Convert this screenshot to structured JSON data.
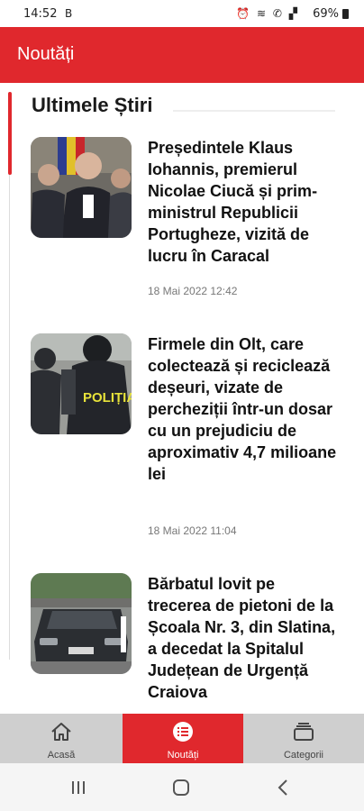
{
  "status_bar": {
    "time": "14:52",
    "left_icon": "B",
    "icons": [
      "alarm-icon",
      "wifi-icon",
      "call-signal-icon",
      "signal-icon"
    ],
    "battery": "69%"
  },
  "app_bar": {
    "title": "Noutăți"
  },
  "section": {
    "title": "Ultimele Știri"
  },
  "articles": [
    {
      "headline": "Președintele Klaus Iohannis, premierul Nicolae Ciucă și prim-ministrul Republicii Portugheze, vizită de lucru în Caracal",
      "date": "18 Mai 2022 12:42",
      "image": "officials-photo"
    },
    {
      "headline": "Firmele din Olt, care colectează și reciclează deșeuri, vizate de percheziții într-un dosar cu un prejudiciu de aproximativ 4,7 milioane lei",
      "date": "18 Mai 2022 11:04",
      "image": "police-photo",
      "image_text": "POLIȚIA"
    },
    {
      "headline": "Bărbatul lovit pe trecerea de pietoni de la Școala Nr. 3, din Slatina, a decedat la Spitalul Județean de Urgență Craiova",
      "image": "car-photo"
    }
  ],
  "bottom_nav": [
    {
      "label": "Acasă",
      "icon": "home-icon",
      "active": false
    },
    {
      "label": "Noutăți",
      "icon": "news-list-icon",
      "active": true
    },
    {
      "label": "Categorii",
      "icon": "categories-icon",
      "active": false
    }
  ],
  "colors": {
    "accent": "#e0282d",
    "nav_bg": "#cfcfcf"
  }
}
